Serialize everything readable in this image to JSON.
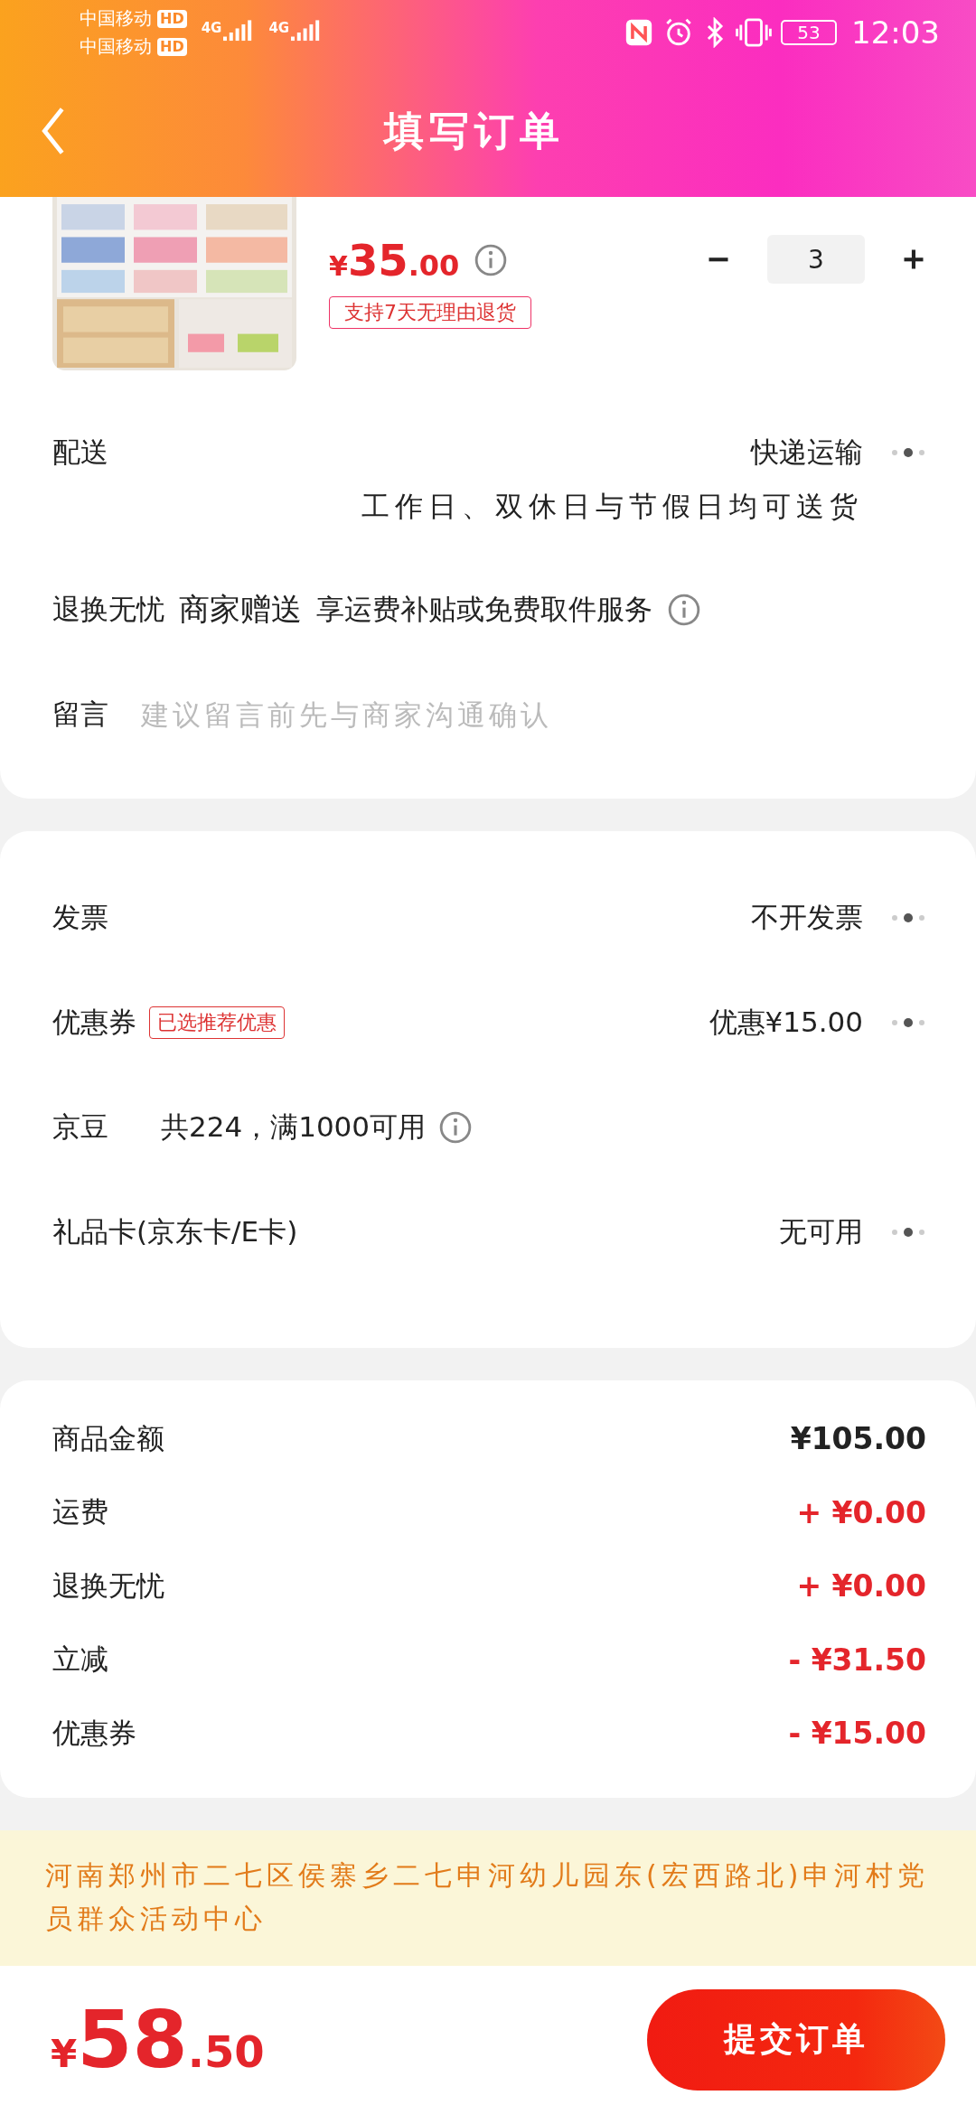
{
  "status_bar": {
    "carriers": [
      {
        "name": "中国移动",
        "badge": "HD"
      },
      {
        "name": "中国移动",
        "badge": "HD"
      }
    ],
    "networks": [
      "4G",
      "4G"
    ],
    "battery": "53",
    "time": "12:03"
  },
  "header": {
    "title": "填写订单"
  },
  "product": {
    "price": {
      "symbol": "¥",
      "integer": "35",
      "decimal": ".00"
    },
    "return_tag": "支持7天无理由退货",
    "quantity": "3"
  },
  "delivery": {
    "label": "配送",
    "value": "快递运输",
    "note": "工作日、双休日与节假日均可送货"
  },
  "return_service": {
    "label": "退换无忧",
    "provider": "商家赠送",
    "description": "享运费补贴或免费取件服务"
  },
  "message": {
    "label": "留言",
    "placeholder": "建议留言前先与商家沟通确认"
  },
  "options": [
    {
      "label": "发票",
      "value": "不开发票",
      "kind": "more"
    },
    {
      "label": "优惠券",
      "tag": "已选推荐优惠",
      "value": "优惠¥15.00",
      "kind": "more"
    },
    {
      "label": "京豆",
      "value": "共224，满1000可用",
      "kind": "info"
    },
    {
      "label": "礼品卡(京东卡/E卡)",
      "value": "无可用",
      "kind": "more"
    }
  ],
  "summary": [
    {
      "label": "商品金额",
      "amount": "¥105.00",
      "kind": "base"
    },
    {
      "label": "运费",
      "amount": "+ ¥0.00",
      "kind": "change"
    },
    {
      "label": "退换无忧",
      "amount": "+ ¥0.00",
      "kind": "change"
    },
    {
      "label": "立减",
      "amount": "- ¥31.50",
      "kind": "change"
    },
    {
      "label": "优惠券",
      "amount": "- ¥15.00",
      "kind": "change"
    }
  ],
  "address": "河南郑州市二七区侯寨乡二七申河幼儿园东(宏西路北)申河村党员群众活动中心",
  "footer": {
    "total": {
      "symbol": "¥",
      "integer": "58",
      "decimal": ".50"
    },
    "submit": "提交订单"
  }
}
